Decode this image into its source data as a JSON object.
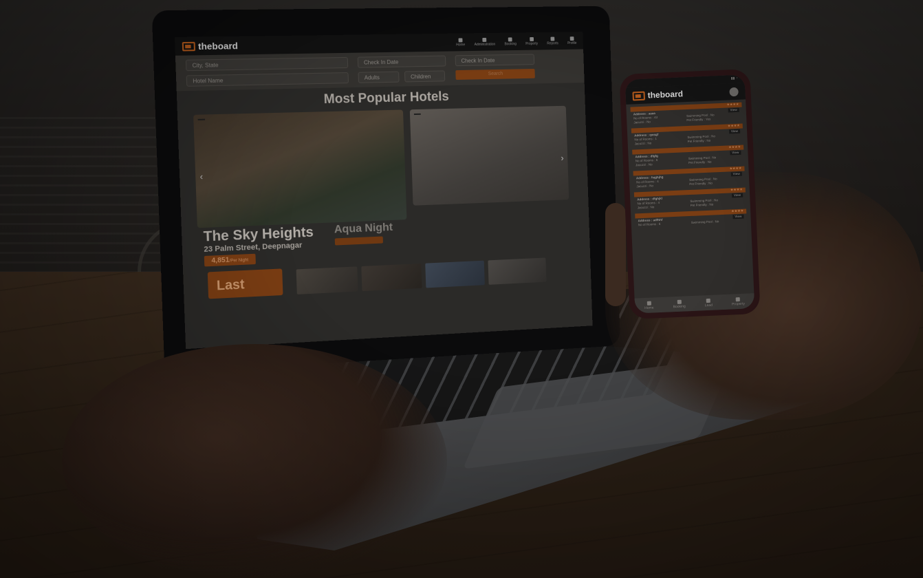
{
  "laptop_app": {
    "brand": "theboard",
    "nav": [
      "Home",
      "Administration",
      "Booking",
      "Property",
      "Reports",
      "Profile"
    ],
    "search": {
      "city_placeholder": "City, State",
      "hotel_placeholder": "Hotel Name",
      "checkin_placeholder": "Check In Date",
      "checkout_placeholder": "Check In Date",
      "adults_placeholder": "Adults",
      "children_placeholder": "Children",
      "search_label": "Search"
    },
    "section_title": "Most Popular Hotels",
    "featured": {
      "name": "The Sky Heights",
      "address": "23 Palm Street, Deepnagar",
      "price": "4,851",
      "price_unit": "/Per Night"
    },
    "secondary": {
      "name": "Aqua Night"
    },
    "last_card_label": "Last",
    "accent_color": "#e8641f"
  },
  "phone_app": {
    "brand": "theboard",
    "properties": [
      {
        "address": "Address : aaaa",
        "rooms": "No of Rooms : 43",
        "pool": "Swimming Pool : No",
        "jacuzzi": "Jacuzzi : No",
        "pet": "Pet Friendly : Yes"
      },
      {
        "address": "Address : qwsgf",
        "rooms": "No of Rooms : 1",
        "pool": "Swimming Pool : No",
        "jacuzzi": "Jacuzzi : No",
        "pet": "Pet Friendly : No"
      },
      {
        "address": "Address : dfgfg",
        "rooms": "No of Rooms : 6",
        "pool": "Swimming Pool : No",
        "jacuzzi": "Jacuzzi : No",
        "pet": "Pet Friendly : No"
      },
      {
        "address": "Address : fsgjhjhg",
        "rooms": "No of Rooms : 4",
        "pool": "Swimming Pool : No",
        "jacuzzi": "Jacuzzi : No",
        "pet": "Pet Friendly : No"
      },
      {
        "address": "Address : dfghjkl",
        "rooms": "No of Rooms : 4",
        "pool": "Swimming Pool : No",
        "jacuzzi": "Jacuzzi : No",
        "pet": "Pet Friendly : No"
      },
      {
        "address": "Address : adfhhf",
        "rooms": "No of Rooms : 6",
        "pool": "Swimming Pool : No",
        "jacuzzi": "",
        "pet": ""
      }
    ],
    "view_label": "View",
    "tabs": [
      "Home",
      "Booking",
      "Lead",
      "Property"
    ]
  }
}
